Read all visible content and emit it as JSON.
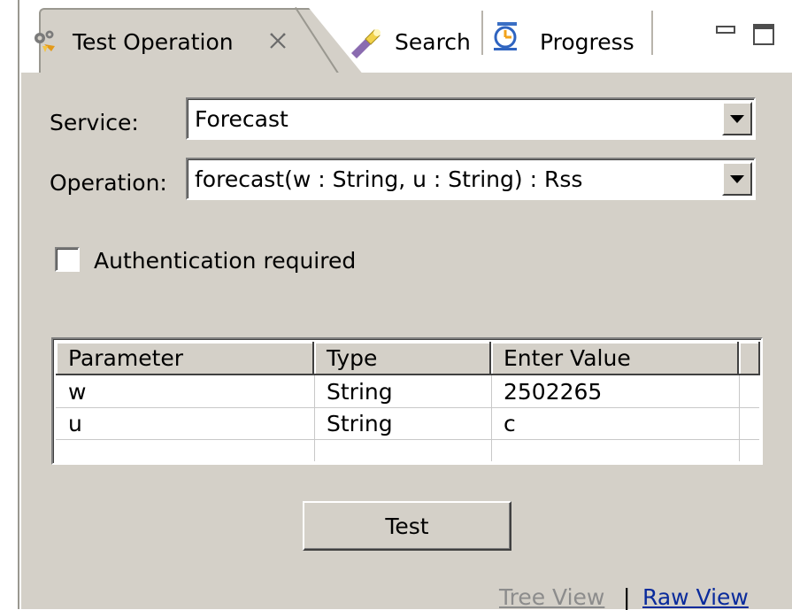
{
  "tabs": [
    {
      "label": "Test Operation",
      "icon": "gears-icon",
      "active": true,
      "closable": true
    },
    {
      "label": "Search",
      "icon": "flashlight-icon",
      "active": false
    },
    {
      "label": "Progress",
      "icon": "progress-icon",
      "active": false
    }
  ],
  "form": {
    "service_label": "Service:",
    "service_value": "Forecast",
    "operation_label": "Operation:",
    "operation_value": "forecast(w : String, u : String) : Rss",
    "auth_label": "Authentication required",
    "auth_checked": false
  },
  "table": {
    "headers": [
      "Parameter",
      "Type",
      "Enter Value"
    ],
    "rows": [
      [
        "w",
        "String",
        "2502265"
      ],
      [
        "u",
        "String",
        "c"
      ]
    ]
  },
  "actions": {
    "test_label": "Test"
  },
  "view_links": {
    "tree_view": "Tree View",
    "separator": "|",
    "raw_view": "Raw View"
  },
  "colors": {
    "panel_bg": "#d4d0c8",
    "link_blue": "#0a2b9c",
    "disabled_gray": "#8c8c8c"
  }
}
